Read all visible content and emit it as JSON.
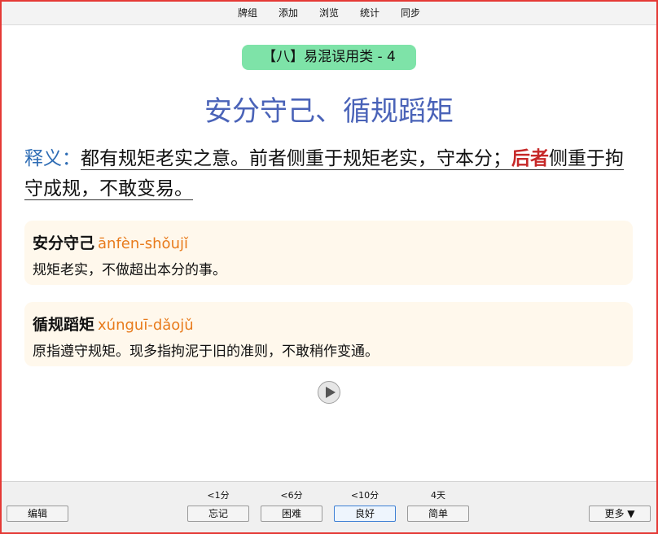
{
  "topbar": {
    "items": [
      "牌组",
      "添加",
      "浏览",
      "统计",
      "同步"
    ]
  },
  "card": {
    "tag": "【八】易混误用类 - 4",
    "title": "安分守己、循规蹈矩",
    "definition": {
      "label": "释义：",
      "text1": "都有规矩老实之意。前者侧重于规矩老实，守本分；",
      "strong": "后者",
      "text2": "侧重于拘守成规，不敢变易。"
    },
    "entries": [
      {
        "word": "安分守己",
        "pinyin": "ānfèn-shǒujǐ",
        "meaning": "规矩老实，不做超出本分的事。"
      },
      {
        "word": "循规蹈矩",
        "pinyin": "xúnguī-dǎojǔ",
        "meaning": "原指遵守规矩。现多指拘泥于旧的准则，不敢稍作变通。"
      }
    ]
  },
  "bottom": {
    "edit": "编辑",
    "more": "更多 ▼",
    "answers": [
      {
        "interval": "<1分",
        "label": "忘记"
      },
      {
        "interval": "<6分",
        "label": "困难"
      },
      {
        "interval": "<10分",
        "label": "良好"
      },
      {
        "interval": "4天",
        "label": "简单"
      }
    ]
  },
  "colors": {
    "title": "#4a63b8",
    "tag_bg": "#7ee3a8",
    "definition_label": "#2f6db5",
    "strong": "#c62828",
    "pinyin": "#e87b1c",
    "entry_bg": "#fff8ec",
    "frame": "#e53935"
  }
}
